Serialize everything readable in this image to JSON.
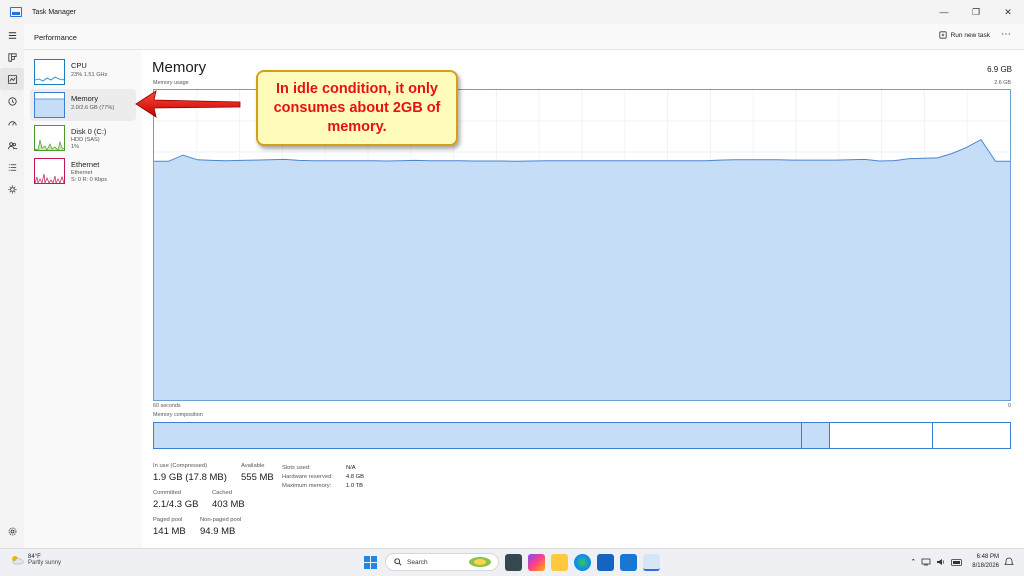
{
  "window": {
    "title": "Task Manager"
  },
  "header": {
    "title": "Performance",
    "run_task_label": "Run new task"
  },
  "sidebar": {
    "items": [
      {
        "name": "CPU",
        "sub1": "23% 1.51 GHz",
        "sub2": "",
        "color": "#1b7fbf"
      },
      {
        "name": "Memory",
        "sub1": "2.0/2.6 GB (77%)",
        "sub2": "",
        "color": "#3b7fd2"
      },
      {
        "name": "Disk 0 (C:)",
        "sub1": "HDD (SAS)",
        "sub2": "1%",
        "color": "#4c9a2a"
      },
      {
        "name": "Ethernet",
        "sub1": "Ethernet",
        "sub2": "S: 0 R: 0 Kbps",
        "color": "#c2185b"
      }
    ]
  },
  "main": {
    "title": "Memory",
    "total": "6.9 GB",
    "usage_label": "Memory usage",
    "usage_max": "2.6 GB",
    "x_left": "60 seconds",
    "x_right": "0",
    "composition_label": "Memory composition",
    "composition": [
      {
        "part": "in_use",
        "fraction": 0.757,
        "color": "#c6ddf8"
      },
      {
        "part": "modified",
        "fraction": 0.033,
        "color": "#c6ddf8"
      },
      {
        "part": "standby",
        "fraction": 0.12,
        "color": "#ffffff"
      },
      {
        "part": "free",
        "fraction": 0.09,
        "color": "#ffffff"
      }
    ],
    "usage_series": [
      0.77,
      0.77,
      0.79,
      0.775,
      0.773,
      0.772,
      0.773,
      0.774,
      0.775,
      0.776,
      0.773,
      0.772,
      0.772,
      0.772,
      0.772,
      0.772,
      0.771,
      0.772,
      0.773,
      0.772,
      0.772,
      0.772,
      0.771,
      0.771,
      0.771,
      0.77,
      0.771,
      0.772,
      0.772,
      0.772,
      0.772,
      0.772,
      0.772,
      0.772,
      0.772,
      0.772,
      0.772,
      0.772,
      0.772,
      0.774,
      0.775,
      0.775,
      0.775,
      0.775,
      0.774,
      0.774,
      0.774,
      0.774,
      0.775,
      0.776,
      0.771,
      0.772,
      0.778,
      0.78,
      0.781,
      0.795,
      0.815,
      0.84,
      0.77,
      0.77
    ],
    "stats": {
      "in_use_label": "In use (Compressed)",
      "in_use": "1.9 GB (17.8 MB)",
      "available_label": "Available",
      "available": "555 MB",
      "committed_label": "Committed",
      "committed": "2.1/4.3 GB",
      "cached_label": "Cached",
      "cached": "403 MB",
      "paged_label": "Paged pool",
      "paged": "141 MB",
      "nonpaged_label": "Non-paged pool",
      "nonpaged": "94.9 MB"
    },
    "details": {
      "slots_label": "Slots used:",
      "slots": "N/A",
      "hw_label": "Hardware reserved:",
      "hw": "4.8 GB",
      "max_label": "Maximum memory:",
      "max": "1.0 TB"
    }
  },
  "callout": {
    "text": "In idle condition, it only consumes about 2GB of memory."
  },
  "taskbar": {
    "temp": "84°F",
    "weather": "Partly sunny",
    "search_label": "Search",
    "time": "6:48 PM",
    "date": "8/18/2026"
  }
}
